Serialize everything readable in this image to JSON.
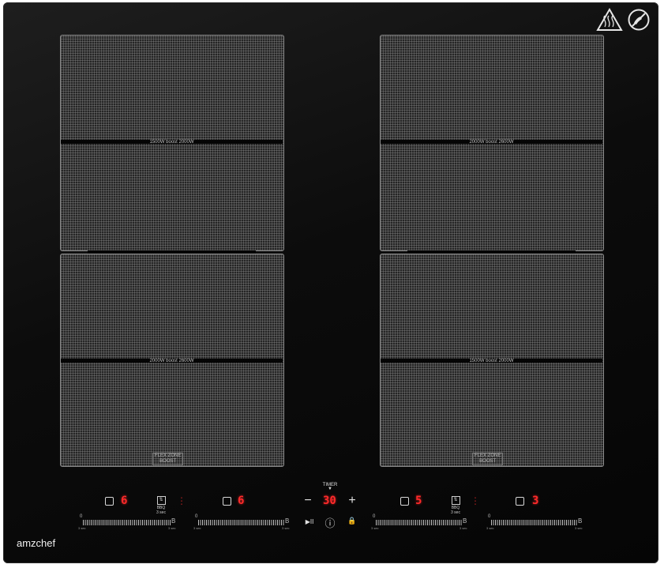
{
  "brand": "amzchef",
  "colors": {
    "display_red": "#ff2a2a",
    "glass": "#0c0c0c",
    "zone_grid": "#8a8a8a"
  },
  "warnings": {
    "hot_surface_icon": "hot-surface-warning-icon",
    "no_touch_icon": "do-not-touch-icon"
  },
  "zones": {
    "top_left_label": "1500W boost 2000W",
    "top_right_label": "2000W boost 2600W",
    "bottom_left_label": "2000W boost 2600W",
    "bottom_right_label": "1500W boost 2000W",
    "flex_zone_line1": "FLEX ZONE",
    "flex_zone_line2": "BOOST"
  },
  "controls": {
    "zone1_level": "6",
    "zone2_level": "6",
    "timer_label": "TIMER",
    "timer_value": "30",
    "timer_minus": "−",
    "timer_plus": "+",
    "zone3_level": "5",
    "zone4_level": "3",
    "bbq_label": "BBQ",
    "bbq_sub": "3 sec",
    "slider_min": "0",
    "slider_max": "B",
    "slider_hold": "3 sec",
    "play_pause": "▶II",
    "power": "ⓘ",
    "lock": "🔒"
  }
}
